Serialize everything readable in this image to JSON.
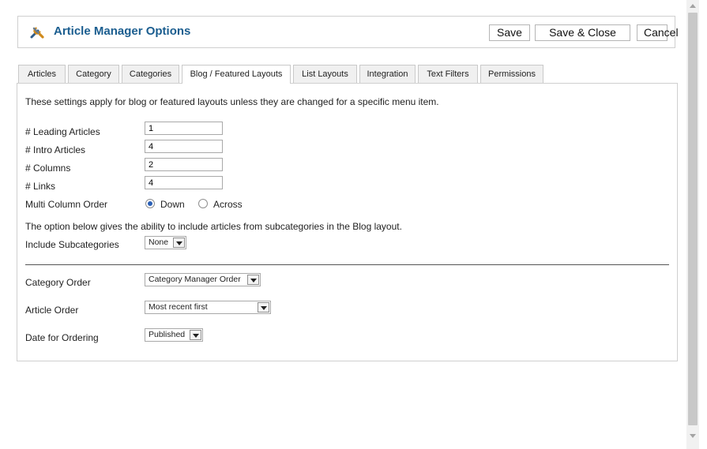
{
  "header": {
    "title": "Article Manager Options",
    "save_label": "Save",
    "save_close_label": "Save & Close",
    "cancel_label": "Cancel"
  },
  "tabs": [
    {
      "label": "Articles",
      "active": false
    },
    {
      "label": "Category",
      "active": false
    },
    {
      "label": "Categories",
      "active": false
    },
    {
      "label": "Blog / Featured Layouts",
      "active": true
    },
    {
      "label": "List Layouts",
      "active": false
    },
    {
      "label": "Integration",
      "active": false
    },
    {
      "label": "Text Filters",
      "active": false
    },
    {
      "label": "Permissions",
      "active": false
    }
  ],
  "panel": {
    "intro": "These settings apply for blog or featured layouts unless they are changed for a specific menu item.",
    "leading_articles": {
      "label": "# Leading Articles",
      "value": "1"
    },
    "intro_articles": {
      "label": "# Intro Articles",
      "value": "4"
    },
    "columns": {
      "label": "# Columns",
      "value": "2"
    },
    "links": {
      "label": "# Links",
      "value": "4"
    },
    "multi_column_order": {
      "label": "Multi Column Order",
      "option_down": "Down",
      "option_across": "Across",
      "selected": "Down"
    },
    "subcat_note": "The option below gives the ability to include articles from subcategories in the Blog layout.",
    "include_subcategories": {
      "label": "Include Subcategories",
      "value": "None"
    },
    "category_order": {
      "label": "Category Order",
      "value": "Category Manager Order"
    },
    "article_order": {
      "label": "Article Order",
      "value": "Most recent first"
    },
    "date_ordering": {
      "label": "Date for Ordering",
      "value": "Published"
    }
  },
  "icons": {
    "title_icon": "tools-icon",
    "scroll_up": "scroll-up-arrow-icon",
    "scroll_down": "scroll-down-arrow-icon"
  },
  "colors": {
    "title": "#1a5d8f",
    "radio_selected": "#2a5fb5"
  }
}
